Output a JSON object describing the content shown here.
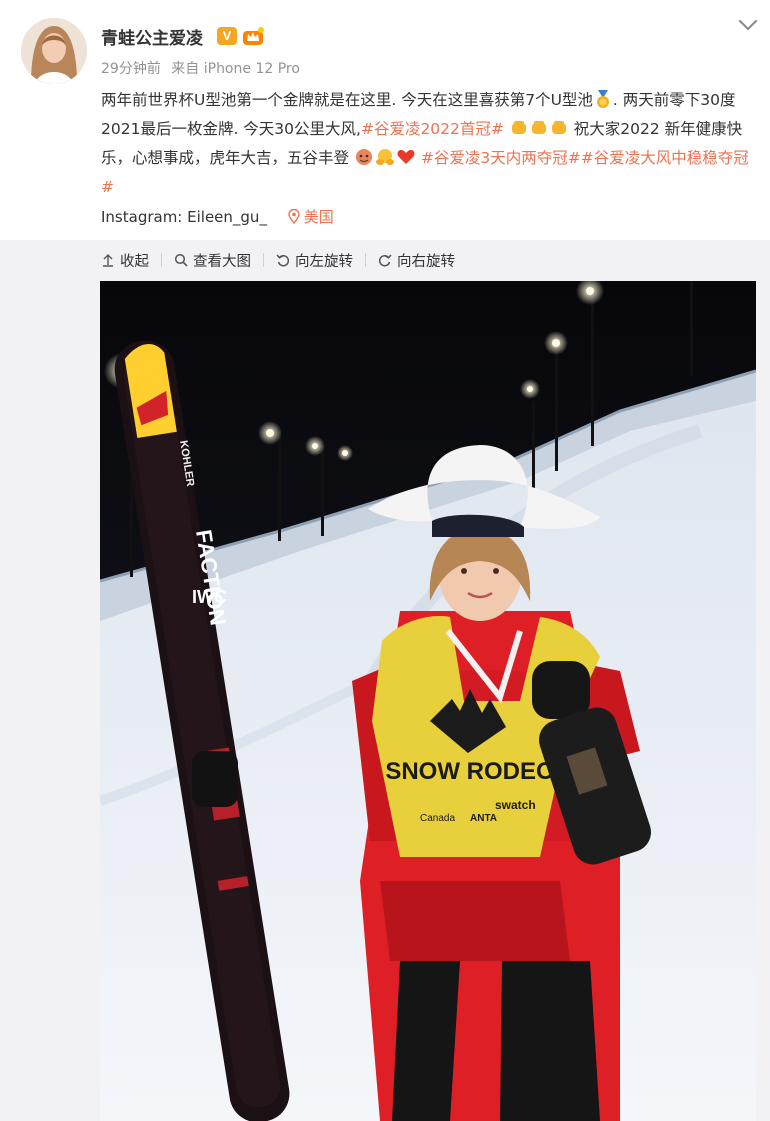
{
  "post": {
    "username": "青蛙公主爱凌",
    "verified_badge": "V",
    "timestamp": "29分钟前",
    "source": "来自 iPhone 12 Pro",
    "text_1": "两年前世界杯U型池第一个金牌就是在这里. 今天在这里喜获第7个U型池",
    "text_2": ". 两天前零下30度2021最后一枚金牌. 今天30公里大风,",
    "hashtag_1": "#谷爱凌2022首冠#",
    "text_3": "祝大家2022 新年健康快乐，心想事成，虎年大吉，五谷丰登",
    "hashtag_2": "#谷爱凌3天内两夺冠#",
    "hashtag_3": "#谷爱凌大风中稳稳夺冠#",
    "instagram": "Instagram: Eileen_gu_",
    "location": "美国"
  },
  "toolbar": {
    "collapse": "收起",
    "view_large": "查看大图",
    "rotate_left": "向左旋转",
    "rotate_right": "向右旋转"
  },
  "photo": {
    "ski_brand": "FACTION",
    "ski_sponsor": "IWC",
    "ski_top_brand": "KOHLER",
    "bib_text": "SNOW RODEO",
    "bib_sponsor_1": "Canada",
    "bib_sponsor_2": "ANTA",
    "bib_sponsor_3": "swatch"
  },
  "colors": {
    "accent": "#eb7350",
    "meta_gray": "#939393",
    "panel_bg": "#f2f2f5",
    "verified": "#f5a623"
  },
  "icons": {
    "collapse": "arrow-up-icon",
    "view_large": "search-icon",
    "rotate_left": "rotate-left-icon",
    "rotate_right": "rotate-right-icon",
    "location": "pin-icon",
    "more": "chevron-down-icon"
  }
}
